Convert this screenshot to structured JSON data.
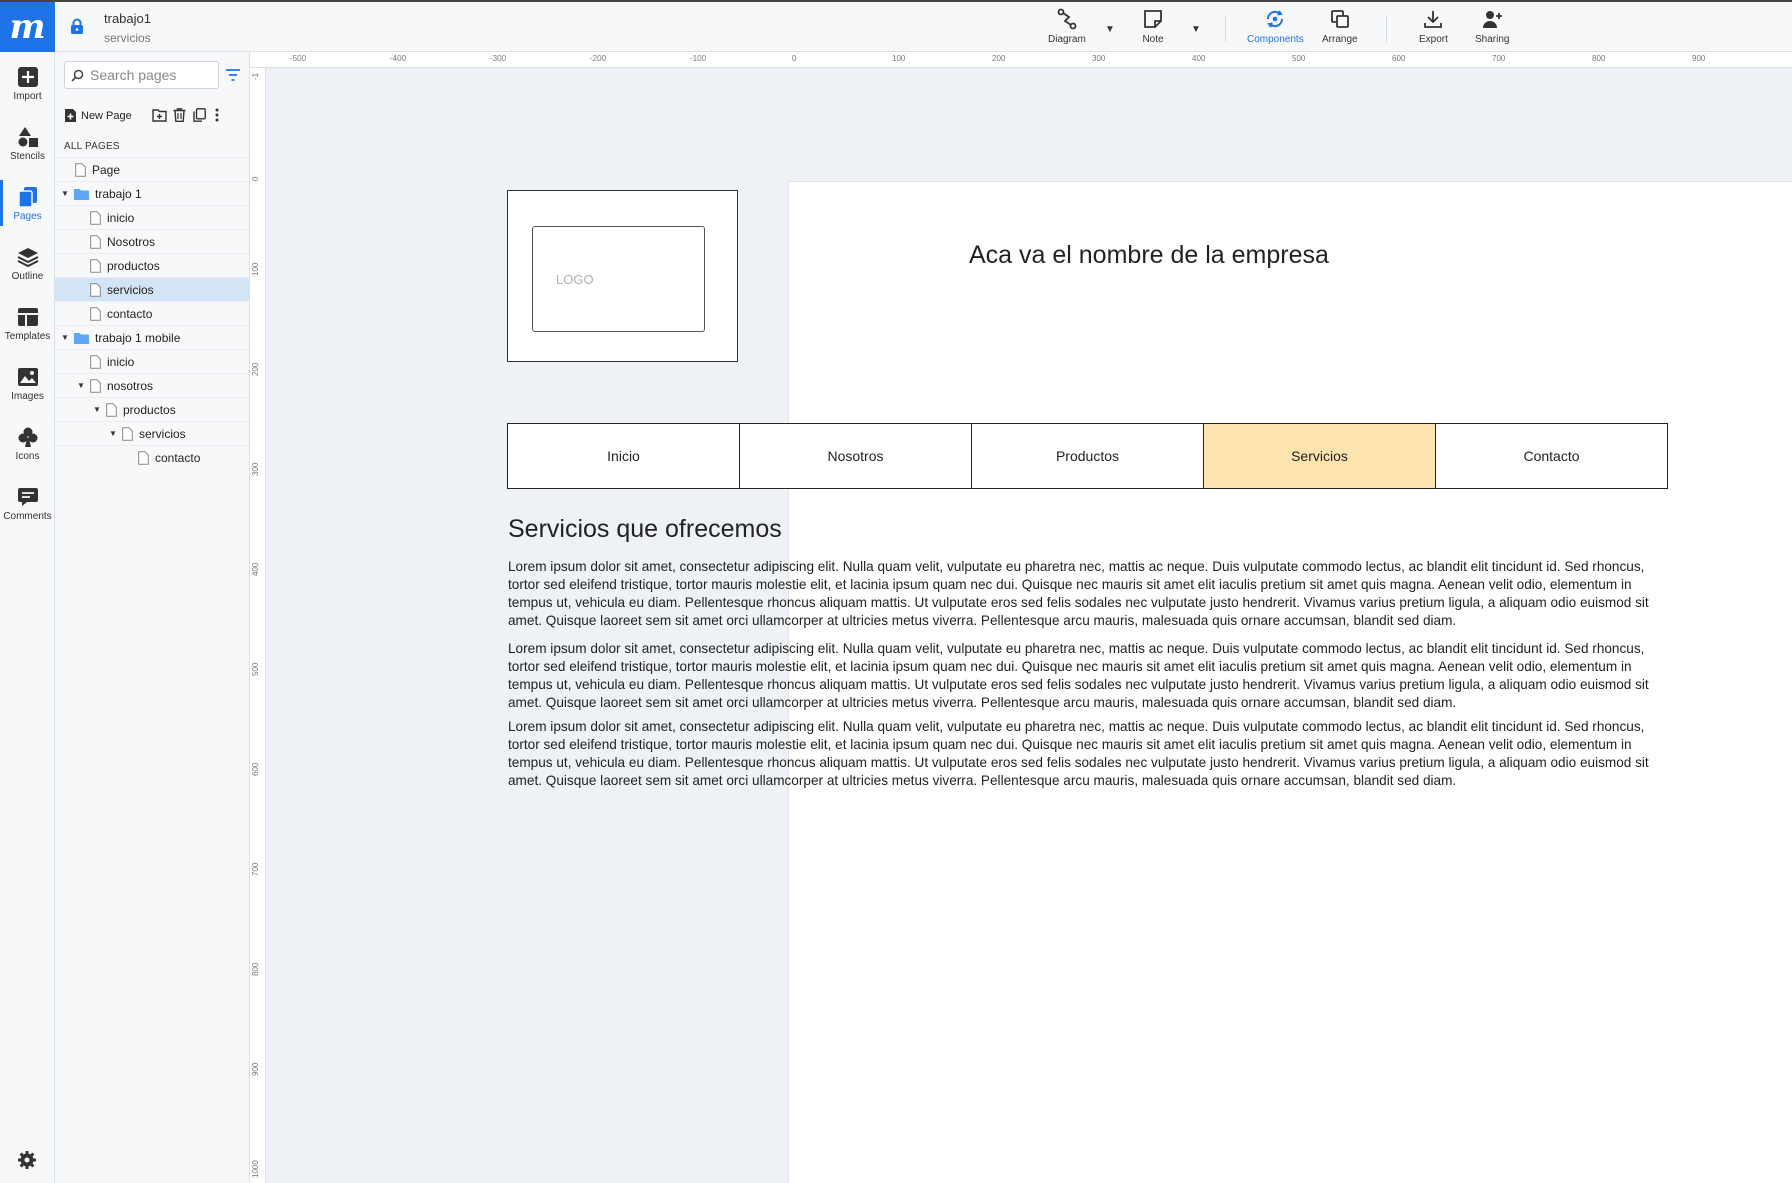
{
  "app": {
    "logo_glyph": "m",
    "doc_title": "trabajo1",
    "doc_subtitle": "servicios",
    "accent": "#1e73e8"
  },
  "toolbar": {
    "diagram": "Diagram",
    "note": "Note",
    "components": "Components",
    "arrange": "Arrange",
    "export": "Export",
    "sharing": "Sharing"
  },
  "rail": {
    "import": "Import",
    "stencils": "Stencils",
    "pages": "Pages",
    "outline": "Outline",
    "templates": "Templates",
    "images": "Images",
    "icons": "Icons",
    "comments": "Comments"
  },
  "pages_panel": {
    "search_placeholder": "Search pages",
    "new_page": "New Page",
    "all_pages": "ALL PAGES",
    "items": [
      {
        "label": "Page"
      },
      {
        "label": "trabajo 1"
      },
      {
        "label": "inicio"
      },
      {
        "label": "Nosotros"
      },
      {
        "label": "productos"
      },
      {
        "label": "servicios"
      },
      {
        "label": "contacto"
      },
      {
        "label": "trabajo 1 mobile"
      },
      {
        "label": "inicio"
      },
      {
        "label": "nosotros"
      },
      {
        "label": "productos"
      },
      {
        "label": "servicios"
      },
      {
        "label": "contacto"
      }
    ]
  },
  "ruler": {
    "top": [
      "-500",
      "-400",
      "-300",
      "-200",
      "-100",
      "0",
      "100",
      "200",
      "300",
      "400",
      "500",
      "600",
      "700",
      "800",
      "900"
    ],
    "left": [
      "-1",
      "0",
      "100",
      "200",
      "300",
      "400",
      "500",
      "600",
      "700",
      "800",
      "900",
      "1000"
    ]
  },
  "wireframe": {
    "logo_text": "LOGO",
    "company_name": "Aca va el nombre de la empresa",
    "nav": [
      "Inicio",
      "Nosotros",
      "Productos",
      "Servicios",
      "Contacto"
    ],
    "nav_active_color": "#fde3ad",
    "section_title": "Servicios que ofrecemos",
    "paragraphs": [
      "Lorem ipsum dolor sit amet, consectetur adipiscing elit. Nulla quam velit, vulputate eu pharetra nec, mattis ac neque. Duis vulputate commodo lectus, ac blandit elit tincidunt id. Sed rhoncus, tortor sed eleifend tristique, tortor mauris molestie elit, et lacinia ipsum quam nec dui. Quisque nec mauris sit amet elit iaculis pretium sit amet quis magna. Aenean velit odio, elementum in tempus ut, vehicula eu diam. Pellentesque rhoncus aliquam mattis. Ut vulputate eros sed felis sodales nec vulputate justo hendrerit. Vivamus varius pretium ligula, a aliquam odio euismod sit amet. Quisque laoreet sem sit amet orci ullamcorper at ultricies metus viverra. Pellentesque arcu mauris, malesuada quis ornare accumsan, blandit sed diam.",
      "Lorem ipsum dolor sit amet, consectetur adipiscing elit. Nulla quam velit, vulputate eu pharetra nec, mattis ac neque. Duis vulputate commodo lectus, ac blandit elit tincidunt id. Sed rhoncus, tortor sed eleifend tristique, tortor mauris molestie elit, et lacinia ipsum quam nec dui. Quisque nec mauris sit amet elit iaculis pretium sit amet quis magna. Aenean velit odio, elementum in tempus ut, vehicula eu diam. Pellentesque rhoncus aliquam mattis. Ut vulputate eros sed felis sodales nec vulputate justo hendrerit. Vivamus varius pretium ligula, a aliquam odio euismod sit amet. Quisque laoreet sem sit amet orci ullamcorper at ultricies metus viverra. Pellentesque arcu mauris, malesuada quis ornare accumsan, blandit sed diam.",
      "Lorem ipsum dolor sit amet, consectetur adipiscing elit. Nulla quam velit, vulputate eu pharetra nec, mattis ac neque. Duis vulputate commodo lectus, ac blandit elit tincidunt id. Sed rhoncus, tortor sed eleifend tristique, tortor mauris molestie elit, et lacinia ipsum quam nec dui. Quisque nec mauris sit amet elit iaculis pretium sit amet quis magna. Aenean velit odio, elementum in tempus ut, vehicula eu diam. Pellentesque rhoncus aliquam mattis. Ut vulputate eros sed felis sodales nec vulputate justo hendrerit. Vivamus varius pretium ligula, a aliquam odio euismod sit amet. Quisque laoreet sem sit amet orci ullamcorper at ultricies metus viverra. Pellentesque arcu mauris, malesuada quis ornare accumsan, blandit sed diam."
    ]
  }
}
